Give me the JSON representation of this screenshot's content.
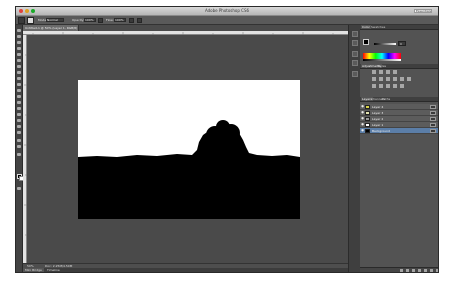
{
  "app": {
    "title": "Adobe Photoshop CS6"
  },
  "search": {
    "placeholder": "Essentials"
  },
  "options_bar": {
    "brush_label": "Brush:",
    "mode_label": "Mode:",
    "mode_value": "Normal",
    "opacity_label": "Opacity:",
    "opacity_value": "100%",
    "flow_label": "Flow:",
    "flow_value": "100%"
  },
  "document": {
    "tab_label": "Untitled-1 @ 50% (Layer 1, RGB/8)",
    "zoom": "50%",
    "doc_size": "Doc: 2.25M/4.50M"
  },
  "bottom_tabs": [
    "Mini Bridge",
    "Timeline"
  ],
  "panels": {
    "color_tabs": [
      "Color",
      "Swatches"
    ],
    "adjustment_tabs": [
      "Adjustments",
      "Styles"
    ],
    "layer_tabs": [
      "Layers",
      "Channels",
      "Paths"
    ],
    "color_value": "0"
  },
  "layers": [
    {
      "name": "Layer 4",
      "thumb_color": "#d8d24a",
      "visible": true,
      "selected": false
    },
    {
      "name": "Layer 3",
      "thumb_color": "#e4e4b0",
      "visible": true,
      "selected": false
    },
    {
      "name": "Layer 2",
      "thumb_color": "#9a9a9a",
      "visible": true,
      "selected": false
    },
    {
      "name": "Layer 1",
      "thumb_color": "#ffffff",
      "visible": true,
      "selected": false
    },
    {
      "name": "Background",
      "thumb_color": "#000000",
      "visible": true,
      "selected": true
    }
  ],
  "colors": {
    "workspace": "#4a4a4a",
    "panel": "#535353",
    "selection": "#5b7ea8",
    "foreground": "#000000",
    "background": "#ffffff"
  }
}
